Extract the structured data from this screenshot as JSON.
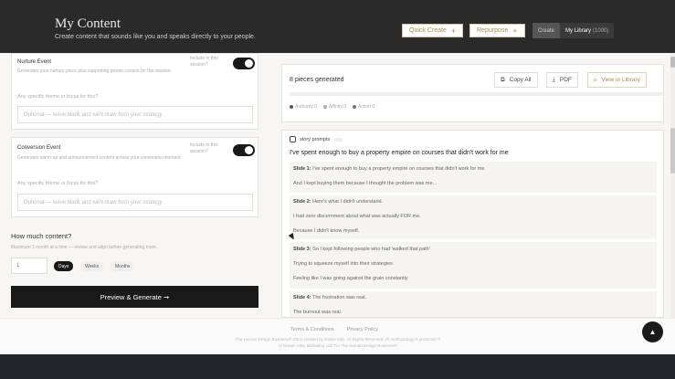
{
  "header": {
    "title": "My Content",
    "subtitle": "Create content that sounds like you and speaks directly to your people.",
    "quick_create": "Quick Create",
    "repurpose": "Repurpose",
    "seg_create": "Create",
    "seg_library": "My Library",
    "seg_library_count": "(1000)"
  },
  "nurture": {
    "title": "Nurture Event",
    "desc": "Generates your nurture piece plus supporting promo content for the session.",
    "include_label": "Include in this session?",
    "question": "Any specific theme or focus for this?",
    "placeholder": "Optional — leave blank and we'll draw from your strategy"
  },
  "conversion": {
    "title": "Conversion Event",
    "desc": "Generates warm-up and announcement content across your conversion moment.",
    "include_label": "Include in this session?",
    "question": "Any specific theme or focus for this?",
    "placeholder": "Optional — leave blank and we'll draw from your strategy"
  },
  "amount": {
    "label": "How much content?",
    "desc": "Maximum 1 month at a time — review and align before generating more.",
    "value": "1",
    "units": [
      "Days",
      "Weeks",
      "Months"
    ],
    "selected_unit": "Days"
  },
  "generate_button": "Preview & Generate ➞",
  "results": {
    "count_text": "8 pieces generated",
    "copy_all": "Copy All",
    "pdf": "PDF",
    "view_library": "View in Library",
    "legend": [
      "Authority 0",
      "Affinity 0",
      "Action 0"
    ]
  },
  "story": {
    "tag": "story prompts",
    "title": "I've spent enough to buy a property empire on courses that didn't work for me",
    "slides": [
      {
        "label": "Slide 1:",
        "text": "I've spent enough to buy a property empire on courses that didn't work for me",
        "extra": [
          "And I kept buying them because I thought the problem was me..."
        ]
      },
      {
        "label": "Slide 2:",
        "text": "Here's what I didn't understand.",
        "extra": [
          "I had zero discernment about what was actually FOR me.",
          "Because I didn't know myself."
        ]
      },
      {
        "label": "Slide 3:",
        "text": "So I kept following people who had 'walked that path'",
        "extra": [
          "Trying to squeeze myself into their strategies",
          "Feeling like I was going against the grain constantly"
        ]
      },
      {
        "label": "Slide 4:",
        "text": "The frustration was real.",
        "extra": [
          "The burnout was real."
        ]
      }
    ]
  },
  "footer": {
    "terms": "Terms & Conditions",
    "privacy": "Privacy Policy",
    "copyright_1": "The Human Design Business® OS is created by Jessie May. All Rights Reserved. All methodology is protected ®",
    "copyright_2": "of Dream Alley Marketing Ltd. T/A The Human Design Business®"
  }
}
